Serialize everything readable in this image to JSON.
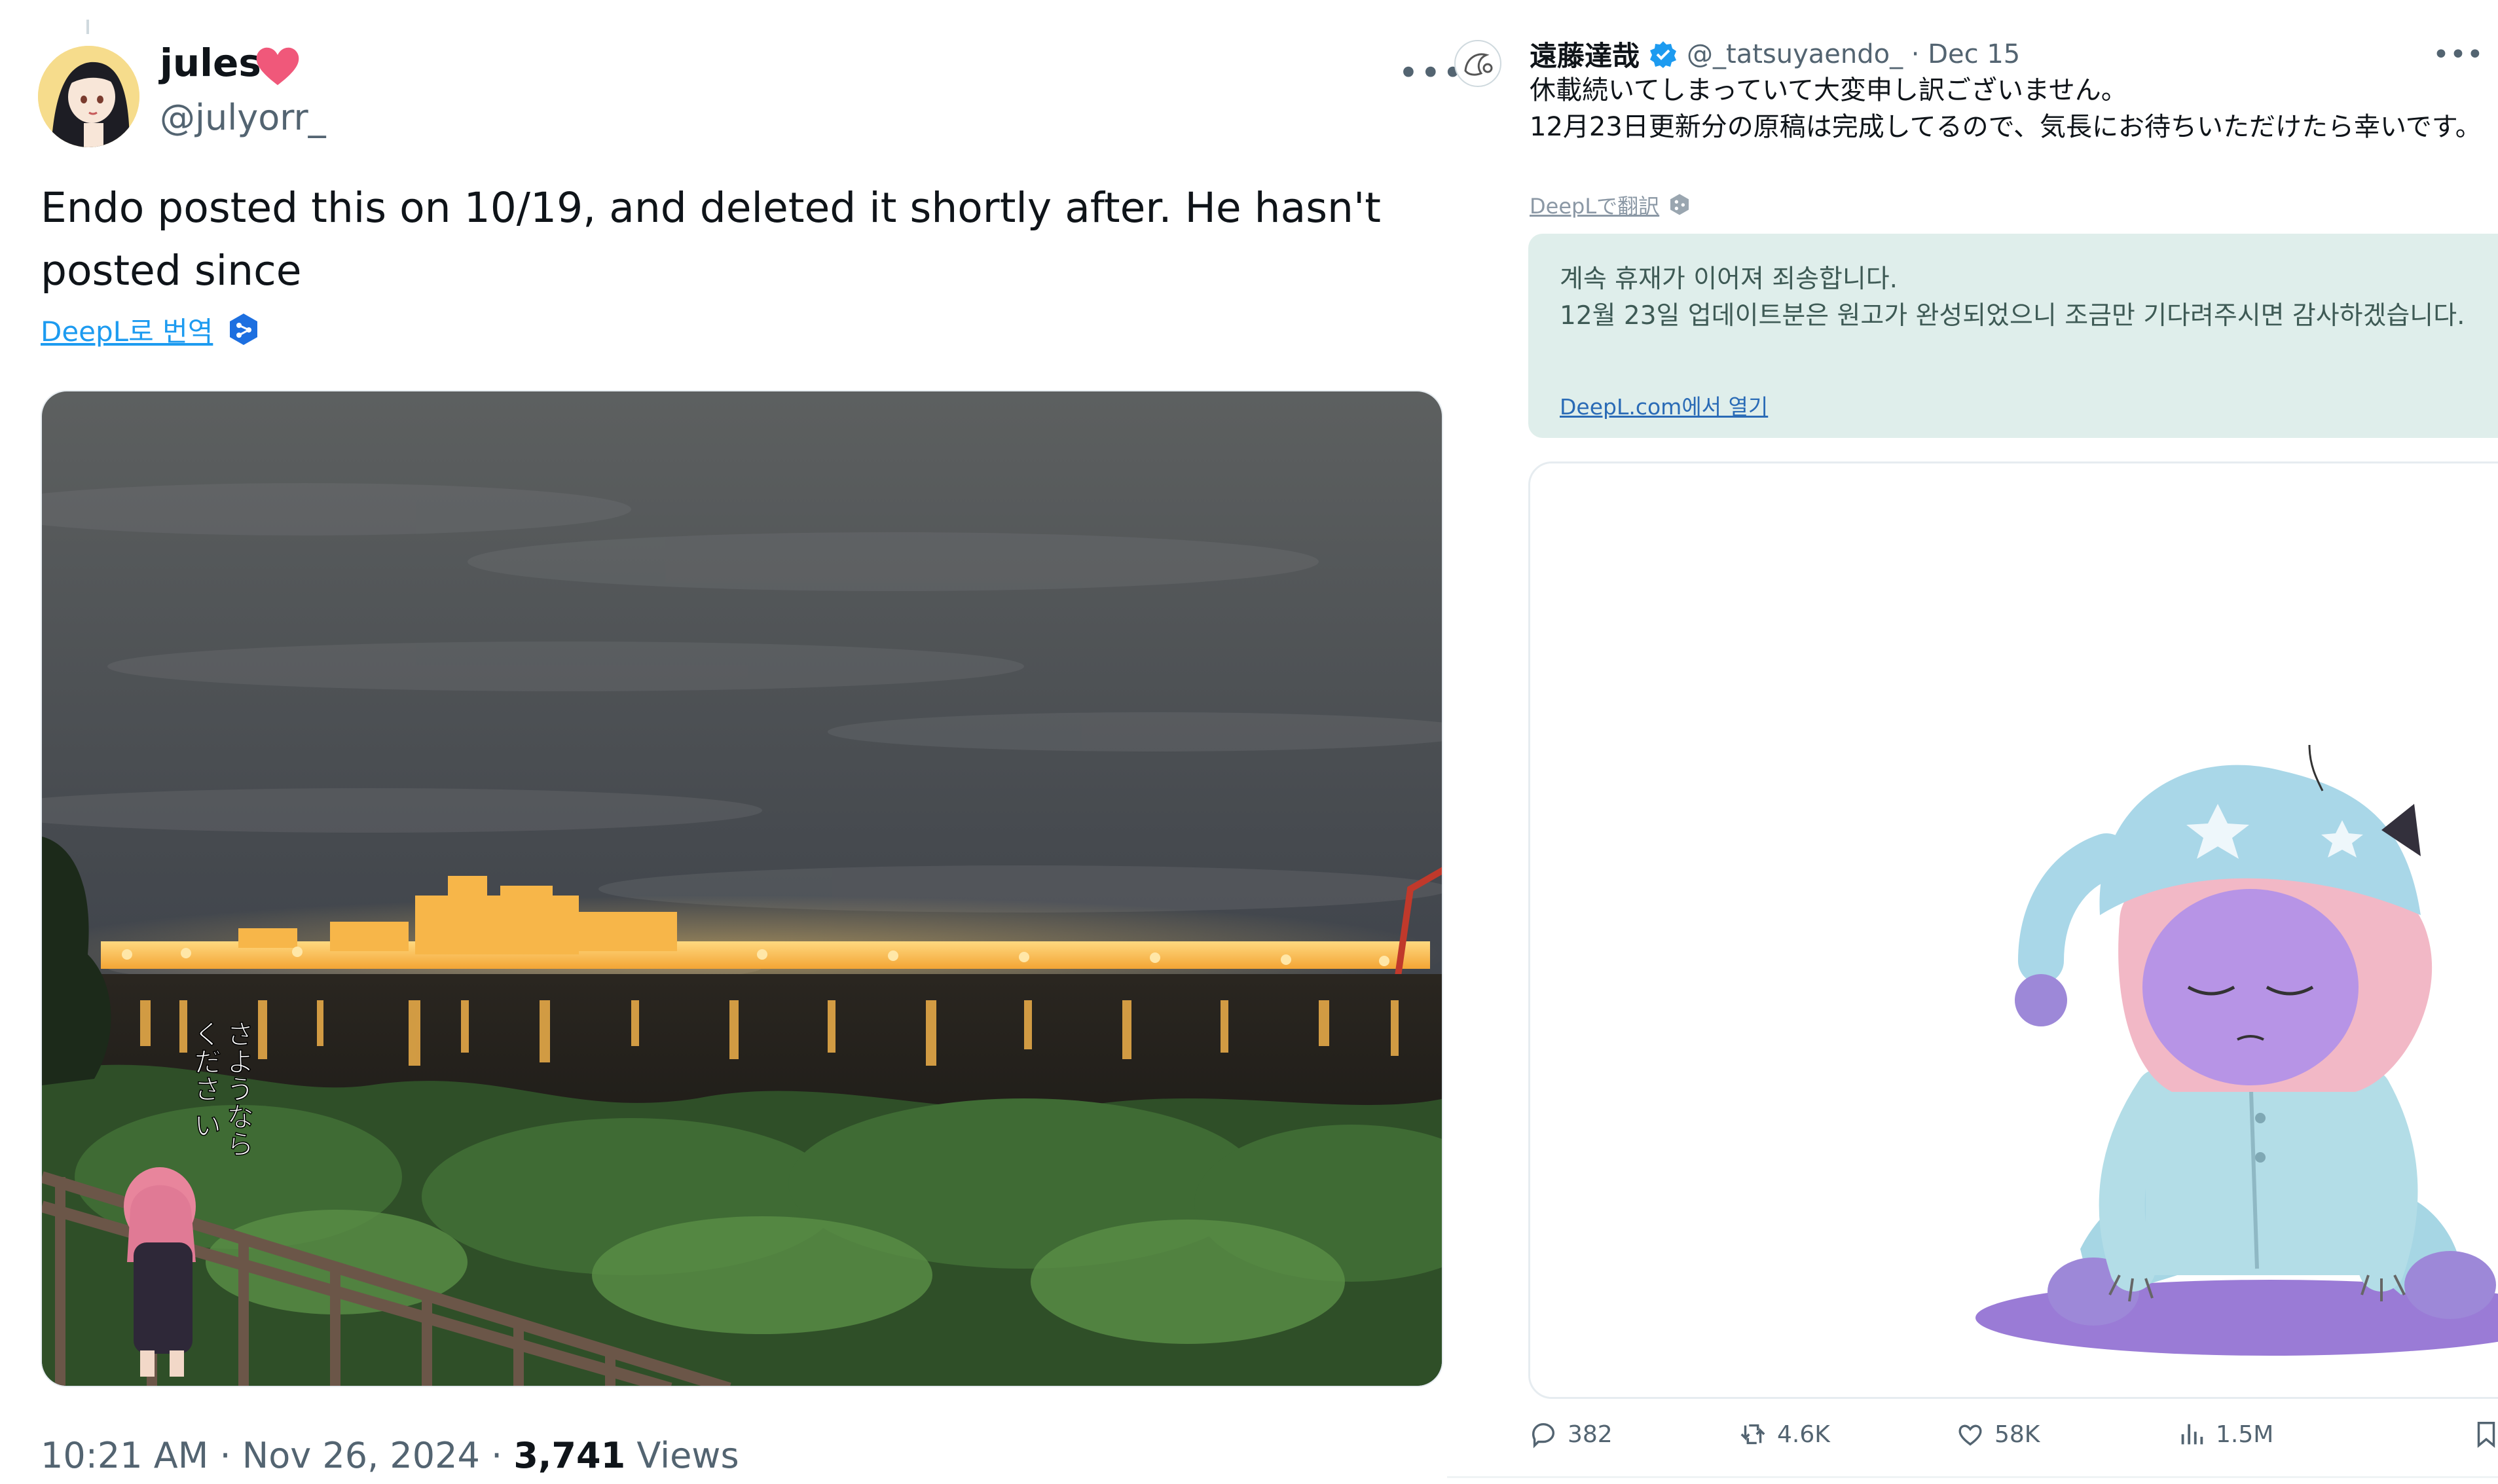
{
  "left_tweet": {
    "display_name": "jules",
    "name_emoji": "heart",
    "handle": "@julyorr_",
    "more_label": "•••",
    "text": "Endo posted this on 10/19, and deleted it shortly after. He hasn't posted since",
    "translate_link": "DeepL로 번역",
    "photo_caption": "さようなら\nくださ い",
    "timestamp": "10:21 AM · Nov 26, 2024 · ",
    "views_count": "3,741",
    "views_label": " Views"
  },
  "right_tweet": {
    "display_name": "遠藤達哉",
    "verified": true,
    "handle_time": "@_tatsuyaendo_ · Dec 15",
    "more_label": "•••",
    "text": "休載続いてしまっていて大変申し訳ございません。\n12月23日更新分の原稿は完成してるので、気長にお待ちいただけたら幸いです。",
    "translate_link": "DeepLで翻訳",
    "translation_text": "계속 휴재가 이어져 죄송합니다.\n12월 23일 업데이트분은 원고가 완성되었으니 조금만 기다려주시면 감사하겠습니다.",
    "translation_open_link": "DeepL.com에서 열기",
    "translation_close": "×",
    "actions": {
      "replies": "382",
      "reposts": "4.6K",
      "likes": "58K",
      "views": "1.5M"
    }
  },
  "colors": {
    "link_blue": "#1d9bf0",
    "secondary_text": "#536471",
    "translation_bg": "#dfeeeb",
    "heart": "#f0587a",
    "verified": "#1d9bf0",
    "deepl_badge": "#1d6fe0"
  }
}
